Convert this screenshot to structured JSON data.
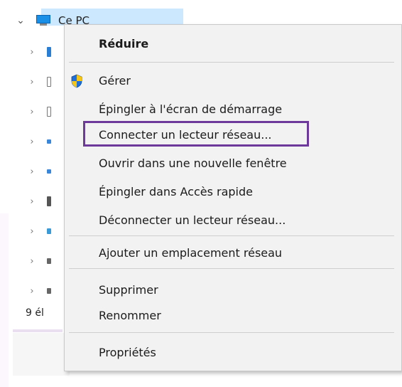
{
  "explorer": {
    "root_label": "Ce PC",
    "status_text": "9 él"
  },
  "context_menu": {
    "items": [
      {
        "label": "Réduire",
        "bold": true
      },
      {
        "label": "Gérer",
        "icon": "uac-shield-icon"
      },
      {
        "label": "Épingler à l'écran de démarrage"
      },
      {
        "label": "Connecter un lecteur réseau...",
        "highlighted": true
      },
      {
        "label": "Ouvrir dans une nouvelle fenêtre"
      },
      {
        "label": "Épingler dans Accès rapide"
      },
      {
        "label": "Déconnecter un lecteur réseau..."
      },
      {
        "label": "Ajouter un emplacement réseau"
      },
      {
        "label": "Supprimer"
      },
      {
        "label": "Renommer"
      },
      {
        "label": "Propriétés"
      }
    ]
  },
  "colors": {
    "selection": "#cce8ff",
    "highlight_outline": "#6d3a9c",
    "menu_background": "#f2f2f2"
  }
}
